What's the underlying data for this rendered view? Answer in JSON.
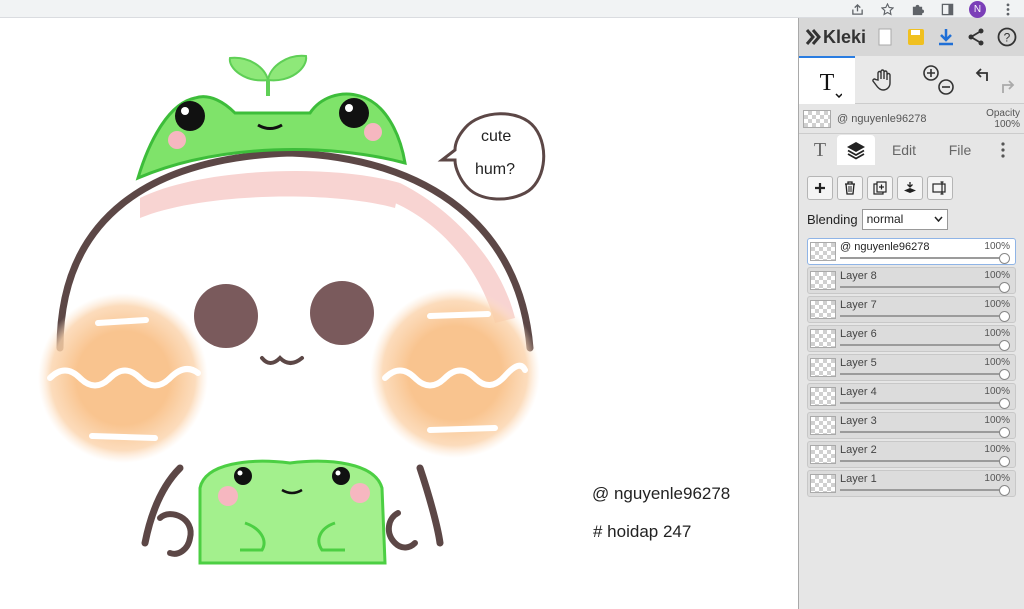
{
  "browser": {
    "icons": [
      "share-icon",
      "star-icon",
      "puzzle-icon",
      "sidepanel-icon",
      "menu-dots-icon"
    ],
    "avatar_letter": "N"
  },
  "canvas": {
    "bubble_line1": "cute",
    "bubble_line2": "hum?",
    "credit_name": "@ nguyenle96278",
    "credit_tag": "# hoidap 247"
  },
  "panel": {
    "app_name": "Kleki",
    "current_layer_name": "@ nguyenle96278",
    "opacity_label": "Opacity",
    "opacity_value": "100%",
    "tabs": [
      "T",
      "Edit",
      "File"
    ],
    "blending_label": "Blending",
    "blending_value": "normal",
    "layers": [
      {
        "name": "@ nguyenle96278",
        "opacity": "100%",
        "selected": true
      },
      {
        "name": "Layer 8",
        "opacity": "100%",
        "selected": false
      },
      {
        "name": "Layer 7",
        "opacity": "100%",
        "selected": false
      },
      {
        "name": "Layer 6",
        "opacity": "100%",
        "selected": false
      },
      {
        "name": "Layer 5",
        "opacity": "100%",
        "selected": false
      },
      {
        "name": "Layer 4",
        "opacity": "100%",
        "selected": false
      },
      {
        "name": "Layer 3",
        "opacity": "100%",
        "selected": false
      },
      {
        "name": "Layer 2",
        "opacity": "100%",
        "selected": false
      },
      {
        "name": "Layer 1",
        "opacity": "100%",
        "selected": false
      }
    ],
    "accent_color": "#2a7de1"
  }
}
